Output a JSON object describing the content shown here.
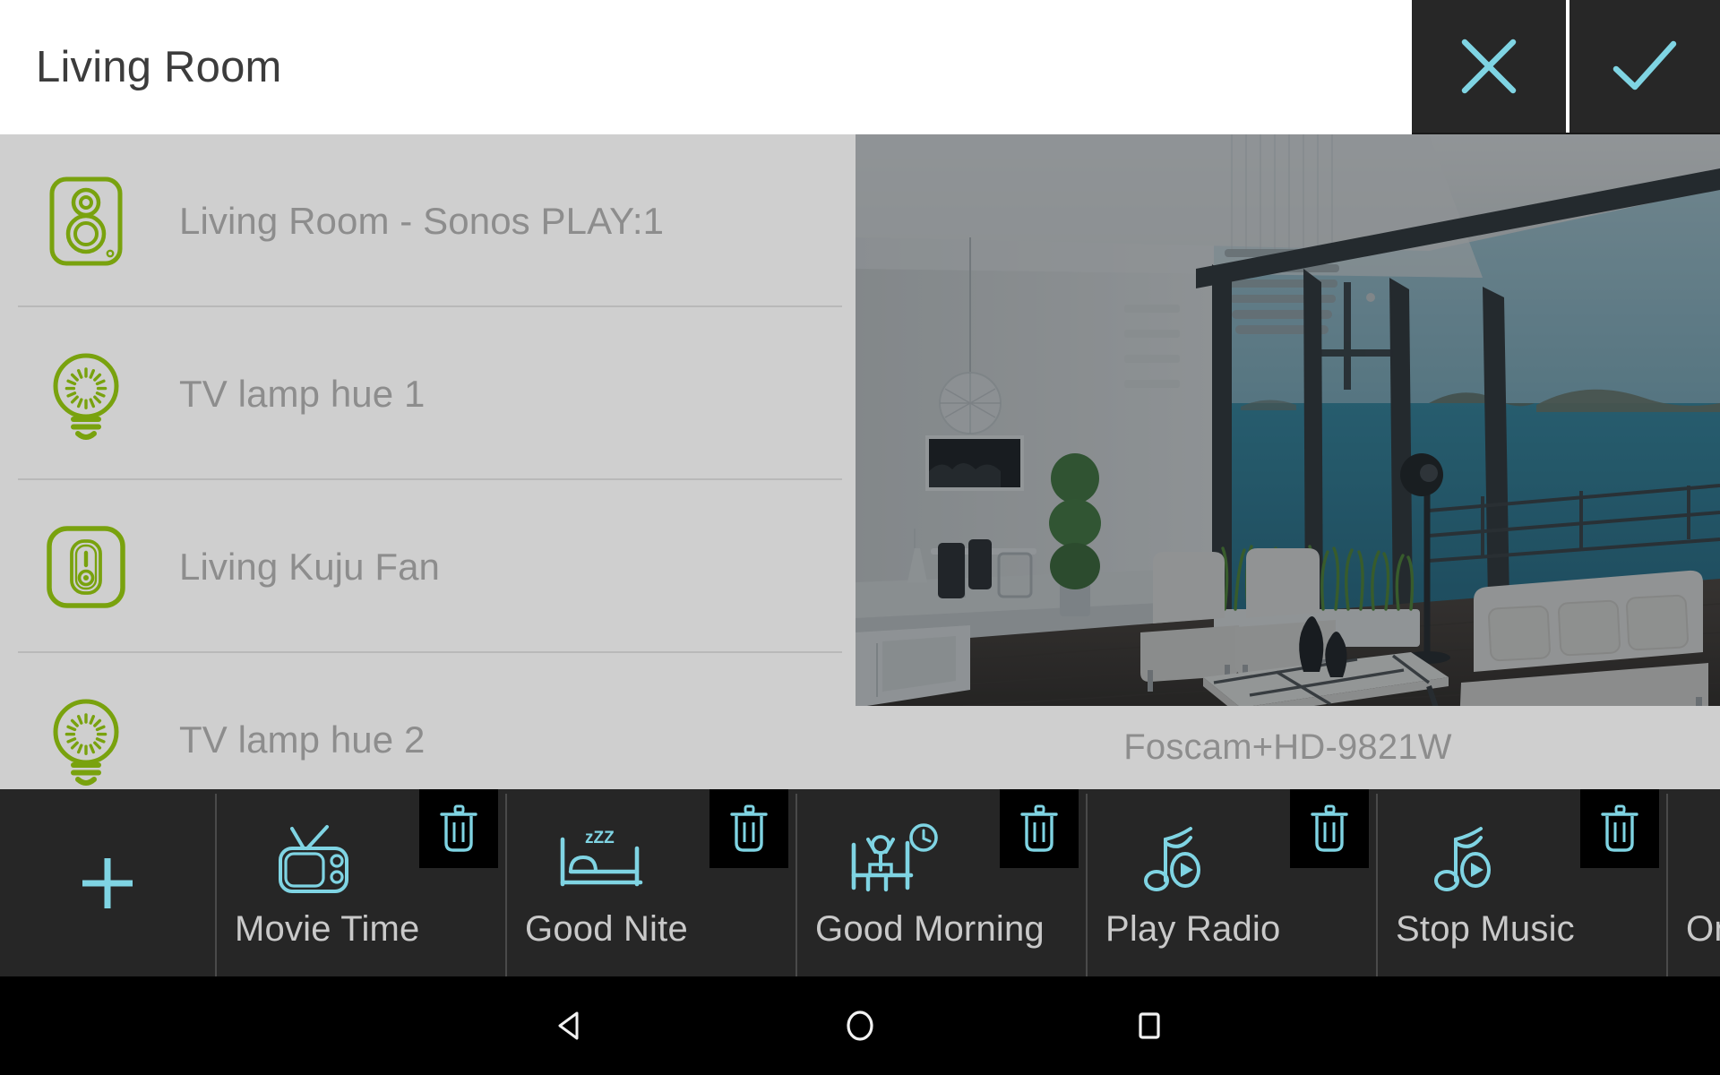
{
  "header": {
    "title": "Living Room",
    "close_label": "close-x",
    "confirm_label": "confirm-check",
    "accent_color": "#7fd4e3",
    "background": "#ffffff",
    "button_background": "#272727"
  },
  "panel": {
    "background": "#cfcfcf",
    "device_icon_color": "#79a20e",
    "text_color": "#8d8d8d"
  },
  "devices": [
    {
      "name": "Living Room - Sonos PLAY:1",
      "icon": "speaker-icon"
    },
    {
      "name": "TV lamp hue 1",
      "icon": "lightbulb-icon"
    },
    {
      "name": "Living Kuju Fan",
      "icon": "switch-icon"
    },
    {
      "name": "TV lamp hue 2",
      "icon": "lightbulb-icon"
    }
  ],
  "camera": {
    "caption": "Foscam+HD-9821W",
    "scene_description": "living-room-ocean-view"
  },
  "scene_bar": {
    "background": "#262626",
    "accent_color": "#7fd4e3",
    "label_color": "#c9c9c9",
    "add_label": "add-scene",
    "delete_label": "delete-scene",
    "scenes": [
      {
        "label": "Movie Time",
        "icon": "television-icon",
        "deletable": true
      },
      {
        "label": "Good Nite",
        "icon": "bed-sleep-icon",
        "deletable": true
      },
      {
        "label": "Good Morning",
        "icon": "wake-up-icon",
        "deletable": true
      },
      {
        "label": "Play Radio",
        "icon": "music-play-icon",
        "deletable": true
      },
      {
        "label": "Stop Music",
        "icon": "music-play-icon",
        "deletable": true
      },
      {
        "label": "On",
        "icon": "clapperboard-icon",
        "deletable": true
      }
    ]
  },
  "navbar": {
    "background": "#000000",
    "back_label": "back",
    "home_label": "home",
    "recents_label": "recents"
  }
}
